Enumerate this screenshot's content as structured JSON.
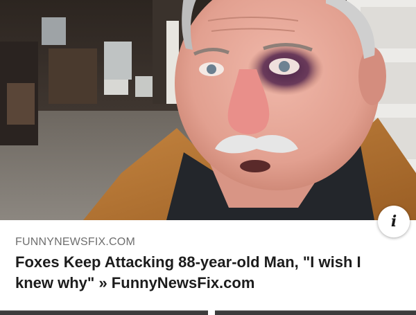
{
  "ad": {
    "source": "FUNNYNEWSFIX.COM",
    "headline": "Foxes Keep Attacking 88-year-old Man, \"I wish I knew why\" » FunnyNewsFix.com",
    "info_glyph": "i"
  },
  "colors": {
    "source_text": "#6e6e6e",
    "headline_text": "#1c1c1c",
    "jacket": "#b9732d",
    "skin": "#e7a99b"
  },
  "icons": {
    "info": "info-icon"
  }
}
